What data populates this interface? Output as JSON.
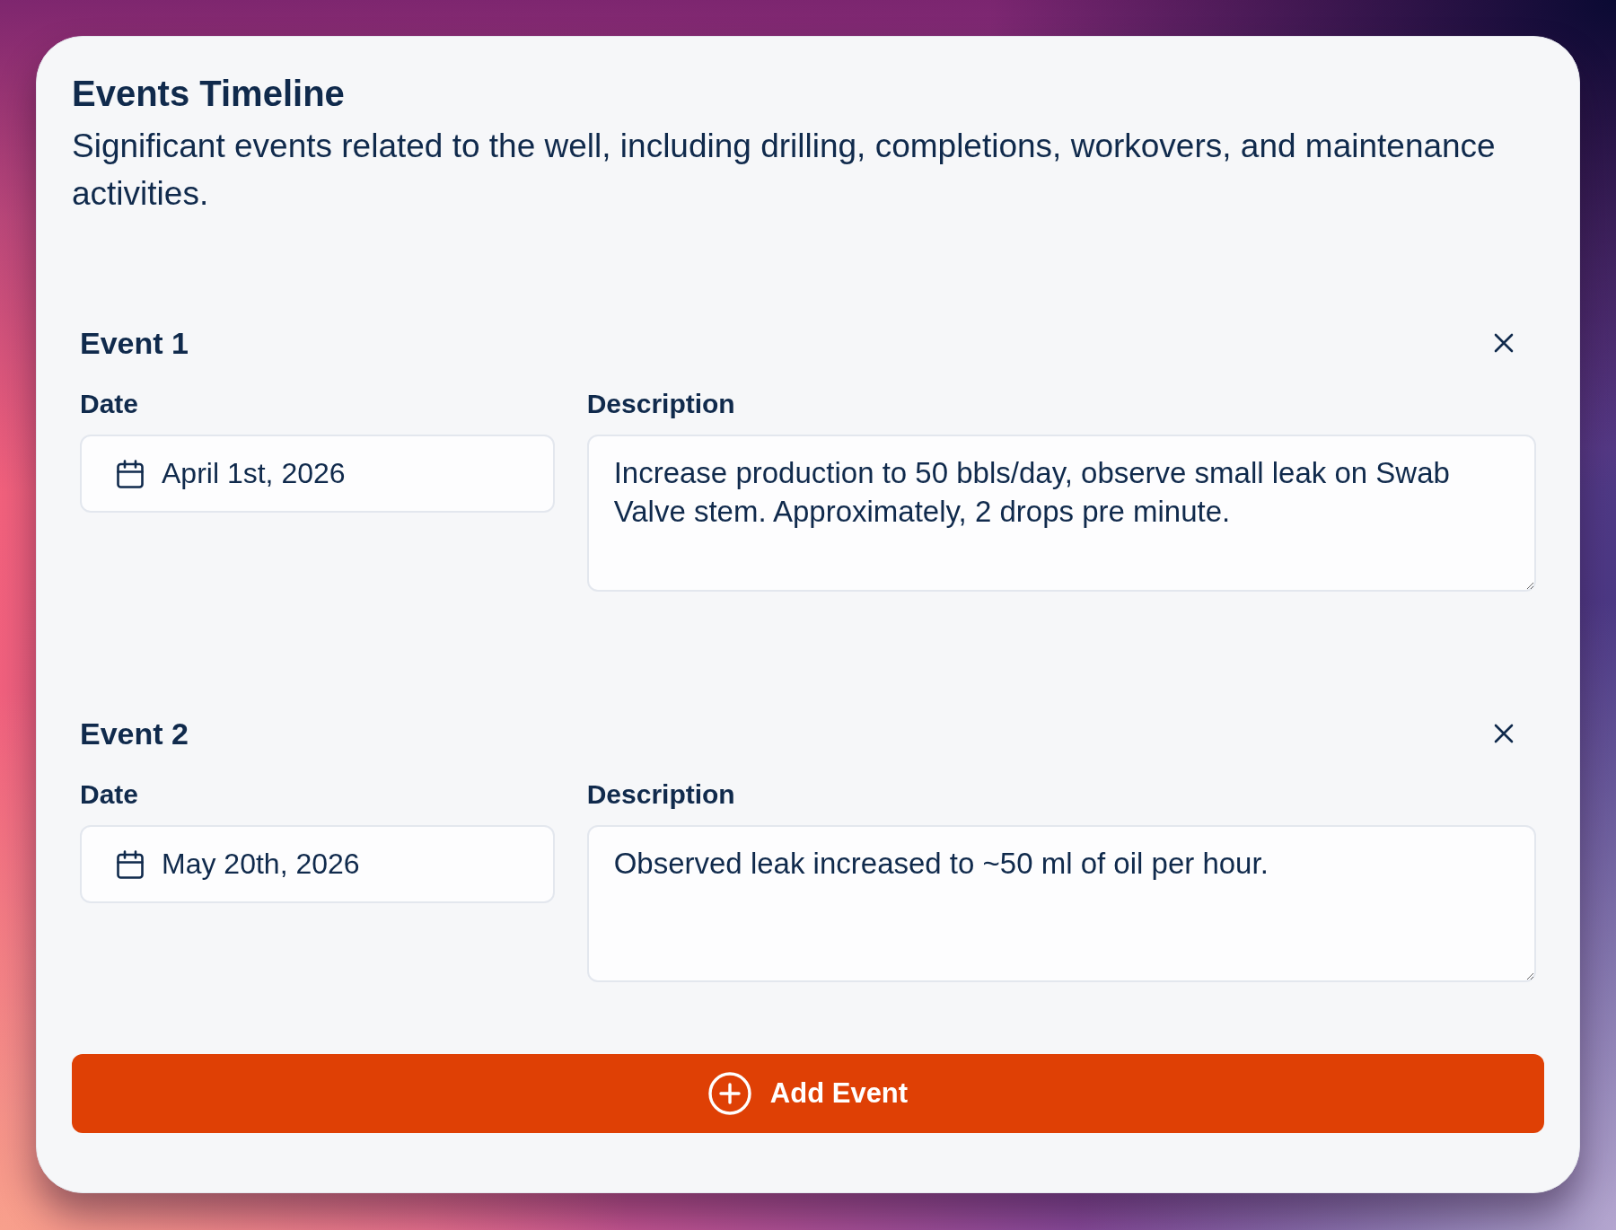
{
  "panel": {
    "title": "Events Timeline",
    "description": "Significant events related to the well, including drilling, completions, workovers, and maintenance activities."
  },
  "events": [
    {
      "heading": "Event 1",
      "date_label": "Date",
      "date": "April 1st, 2026",
      "description_label": "Description",
      "description": "Increase production to 50 bbls/day, observe small leak on Swab Valve stem. Approximately, 2 drops pre minute."
    },
    {
      "heading": "Event 2",
      "date_label": "Date",
      "date": "May 20th, 2026",
      "description_label": "Description",
      "description": "Observed leak increased to ~50 ml of oil per hour."
    }
  ],
  "add_button": {
    "label": "Add Event"
  }
}
